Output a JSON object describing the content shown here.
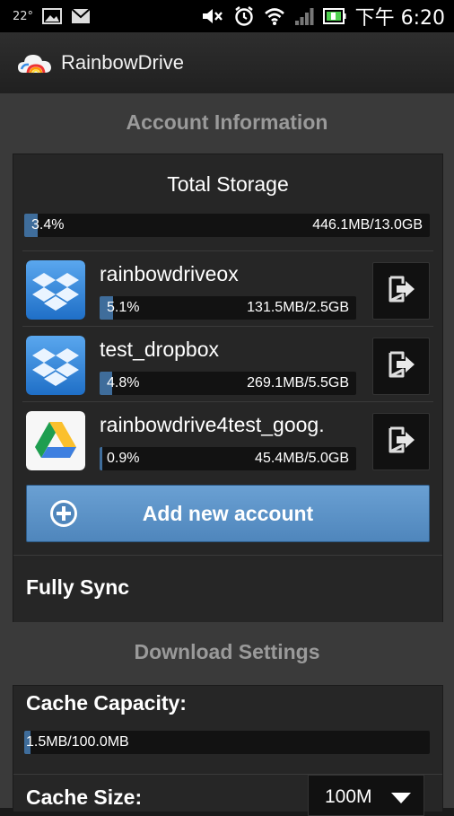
{
  "status_bar": {
    "temperature": "22°",
    "time": "下午 6:20",
    "icons": [
      "image-icon",
      "gmail-icon",
      "mute-icon",
      "alarm-icon",
      "wifi-icon",
      "signal-icon",
      "battery-icon"
    ]
  },
  "app": {
    "title": "RainbowDrive",
    "logo": "rainbow-cloud-logo"
  },
  "account_info": {
    "section_title": "Account Information",
    "total": {
      "label": "Total Storage",
      "percent_text": "3.4%",
      "percent": 3.4,
      "usage": "446.1MB/13.0GB"
    },
    "accounts": [
      {
        "name": "rainbowdriveox",
        "service": "dropbox",
        "percent_text": "5.1%",
        "percent": 5.1,
        "usage": "131.5MB/2.5GB"
      },
      {
        "name": "test_dropbox",
        "service": "dropbox",
        "percent_text": "4.8%",
        "percent": 4.8,
        "usage": "269.1MB/5.5GB"
      },
      {
        "name": "rainbowdrive4test_goog.",
        "service": "google-drive",
        "percent_text": "0.9%",
        "percent": 0.9,
        "usage": "45.4MB/5.0GB"
      }
    ],
    "add_button_label": "Add new account",
    "fully_sync_label": "Fully Sync"
  },
  "download_settings": {
    "section_title": "Download Settings",
    "cache_capacity_label": "Cache Capacity:",
    "cache_usage": "1.5MB/100.0MB",
    "cache_percent": 1.5,
    "cache_size_label": "Cache Size:",
    "cache_size_value": "100M"
  },
  "colors": {
    "accent": "#4f86bc",
    "bar_fill": "#3f6d9b",
    "section_title": "#9a9a9a",
    "background": "#3a3a3a"
  }
}
